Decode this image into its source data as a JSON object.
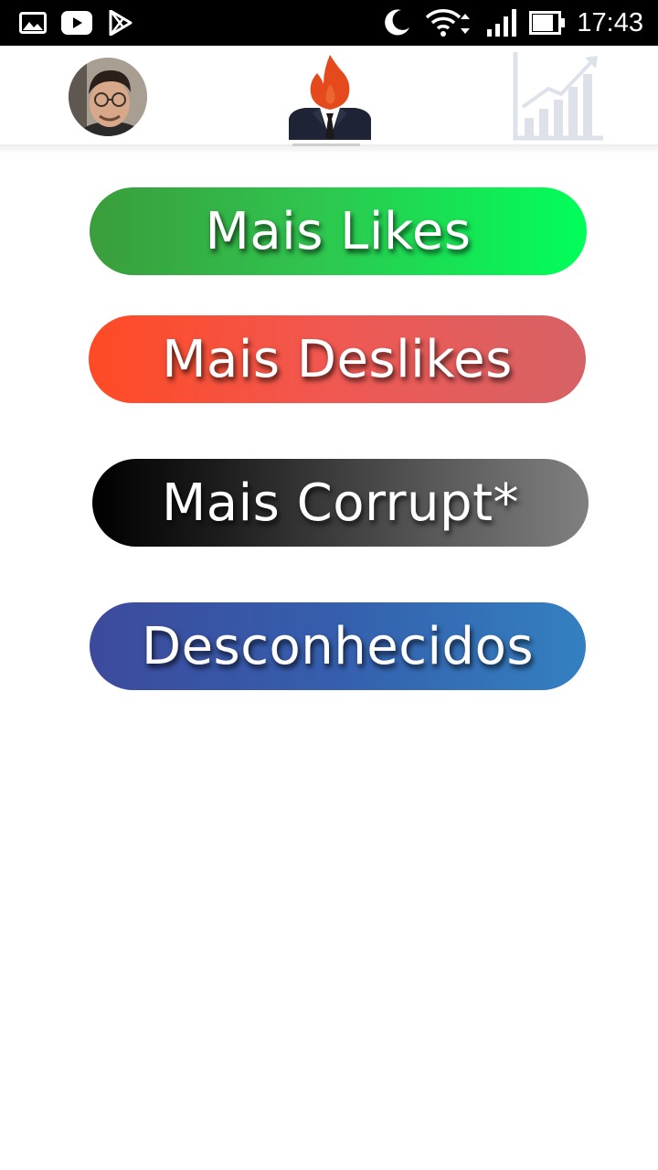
{
  "status_bar": {
    "time": "17:43",
    "left_icons": [
      "gallery-icon",
      "youtube-icon",
      "play-store-icon"
    ],
    "right_icons": [
      "moon-icon",
      "wifi-icon",
      "signal-icon",
      "battery-icon"
    ]
  },
  "nav": {
    "items": [
      "profile-avatar",
      "politician-logo",
      "stats-icon"
    ]
  },
  "buttons": {
    "likes": "Mais Likes",
    "deslikes": "Mais Deslikes",
    "corrupt": "Mais Corrupt*",
    "unknown": "Desconhecidos"
  },
  "colors": {
    "likes": "#2fc54e",
    "deslikes": "#f05852",
    "corrupt": "#3a3a3a",
    "unknown": "#355fae",
    "flame": "#e44a1c"
  }
}
